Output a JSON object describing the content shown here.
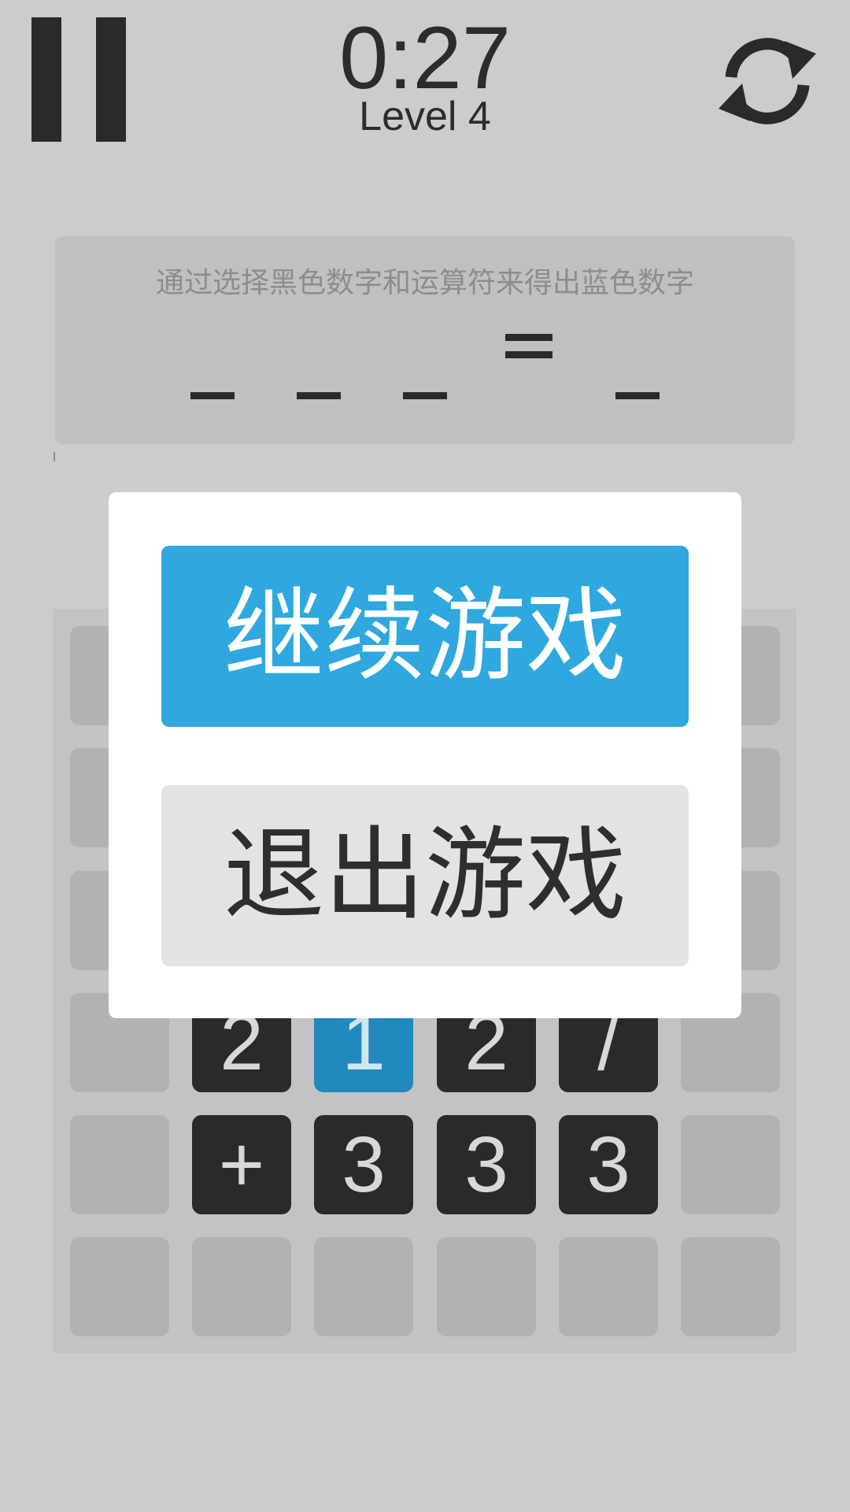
{
  "header": {
    "timer": "0:27",
    "level": "Level 4"
  },
  "icons": {
    "pause": "pause-icon",
    "refresh": "refresh-icon"
  },
  "equation": {
    "instruction": "通过选择黑色数字和运算符来得出蓝色数字",
    "equals_sign": "="
  },
  "grid": {
    "rows": [
      [
        "",
        "",
        "",
        "",
        "",
        ""
      ],
      [
        "",
        "",
        "",
        "",
        "",
        ""
      ],
      [
        "",
        "",
        "",
        "",
        "",
        ""
      ],
      [
        "",
        "2",
        "1",
        "2",
        "/",
        ""
      ],
      [
        "",
        "+",
        "3",
        "3",
        "3",
        ""
      ],
      [
        "",
        "",
        "",
        "",
        "",
        ""
      ]
    ],
    "row4": [
      "2",
      "1",
      "2",
      "/"
    ],
    "row5": [
      "+",
      "3",
      "3",
      "3"
    ]
  },
  "dialog": {
    "continue_label": "继续游戏",
    "quit_label": "退出游戏"
  },
  "colors": {
    "background": "#cdcbce",
    "accent_blue": "#2ea8de",
    "tile_blue": "#2289bd",
    "tile_dark": "#2a2a2a"
  }
}
